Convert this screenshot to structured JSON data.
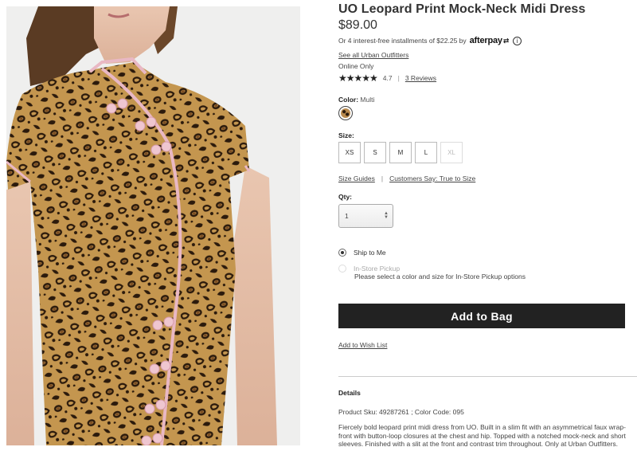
{
  "product": {
    "title": "UO Leopard Print Mock-Neck Midi Dress",
    "price": "$89.00",
    "image_alt": "Model wearing leopard print mock-neck midi dress"
  },
  "afterpay": {
    "text": "Or 4 interest-free installments of $22.25 by",
    "logo": "afterpay",
    "info_icon": "ⓘ"
  },
  "brand_link": "See all Urban Outfitters",
  "availability": "Online Only",
  "rating": {
    "stars_value": 4.7,
    "stars_glyphs": "★★★★★",
    "value_text": "4.7",
    "reviews_link": "3 Reviews"
  },
  "color": {
    "label": "Color:",
    "value": "Multi"
  },
  "size": {
    "label": "Size:",
    "options": [
      {
        "label": "XS",
        "available": true
      },
      {
        "label": "S",
        "available": true
      },
      {
        "label": "M",
        "available": true
      },
      {
        "label": "L",
        "available": true
      },
      {
        "label": "XL",
        "available": false
      }
    ],
    "guide_link": "Size Guides",
    "fit_link": "Customers Say: True to Size"
  },
  "qty": {
    "label": "Qty:",
    "value": "1"
  },
  "fulfillment": {
    "ship_label": "Ship to Me",
    "pickup_label": "In-Store Pickup",
    "pickup_note": "Please select a color and size for In-Store Pickup options"
  },
  "actions": {
    "add_to_bag": "Add to Bag",
    "wishlist": "Add to Wish List"
  },
  "details": {
    "heading": "Details",
    "sku_line": "Product Sku: 49287261 ; Color Code: 095",
    "description": "Fiercely bold leopard print midi dress from UO. Built in a slim fit with an asymmetrical faux wrap-front with button-loop closures at the chest and hip. Topped with a notched mock-neck and short sleeves. Finished with a slit at the front and contrast trim throughout. Only at Urban Outfitters."
  },
  "colors": {
    "accent_dark": "#222222",
    "leopard_base": "#c4964f",
    "trim_pink": "#e9b8c4"
  }
}
